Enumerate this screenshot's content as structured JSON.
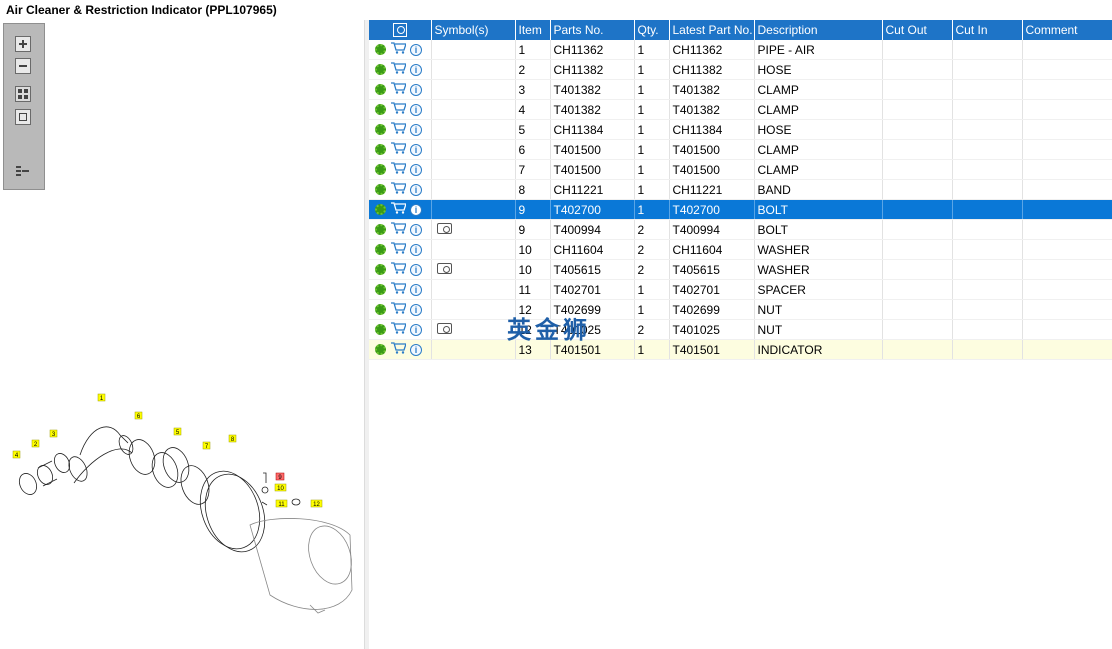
{
  "title": "Air Cleaner & Restriction Indicator (PPL107965)",
  "columns": [
    "",
    "Symbol(s)",
    "Item",
    "Parts No.",
    "Qty.",
    "Latest Part No.",
    "Description",
    "Cut Out",
    "Cut In",
    "Comment"
  ],
  "rows": [
    {
      "symbol": false,
      "item": "1",
      "parts_no": "CH11362",
      "qty": "1",
      "latest": "CH11362",
      "desc": "PIPE - AIR"
    },
    {
      "symbol": false,
      "item": "2",
      "parts_no": "CH11382",
      "qty": "1",
      "latest": "CH11382",
      "desc": "HOSE"
    },
    {
      "symbol": false,
      "item": "3",
      "parts_no": "T401382",
      "qty": "1",
      "latest": "T401382",
      "desc": "CLAMP"
    },
    {
      "symbol": false,
      "item": "4",
      "parts_no": "T401382",
      "qty": "1",
      "latest": "T401382",
      "desc": "CLAMP"
    },
    {
      "symbol": false,
      "item": "5",
      "parts_no": "CH11384",
      "qty": "1",
      "latest": "CH11384",
      "desc": "HOSE"
    },
    {
      "symbol": false,
      "item": "6",
      "parts_no": "T401500",
      "qty": "1",
      "latest": "T401500",
      "desc": "CLAMP"
    },
    {
      "symbol": false,
      "item": "7",
      "parts_no": "T401500",
      "qty": "1",
      "latest": "T401500",
      "desc": "CLAMP"
    },
    {
      "symbol": false,
      "item": "8",
      "parts_no": "CH11221",
      "qty": "1",
      "latest": "CH11221",
      "desc": "BAND"
    },
    {
      "symbol": false,
      "item": "9",
      "parts_no": "T402700",
      "qty": "1",
      "latest": "T402700",
      "desc": "BOLT",
      "state": "selected"
    },
    {
      "symbol": true,
      "item": "9",
      "parts_no": "T400994",
      "qty": "2",
      "latest": "T400994",
      "desc": "BOLT"
    },
    {
      "symbol": false,
      "item": "10",
      "parts_no": "CH11604",
      "qty": "2",
      "latest": "CH11604",
      "desc": "WASHER"
    },
    {
      "symbol": true,
      "item": "10",
      "parts_no": "T405615",
      "qty": "2",
      "latest": "T405615",
      "desc": "WASHER"
    },
    {
      "symbol": false,
      "item": "11",
      "parts_no": "T402701",
      "qty": "1",
      "latest": "T402701",
      "desc": "SPACER"
    },
    {
      "symbol": false,
      "item": "12",
      "parts_no": "T402699",
      "qty": "1",
      "latest": "T402699",
      "desc": "NUT"
    },
    {
      "symbol": true,
      "item": "12",
      "parts_no": "T401025",
      "qty": "2",
      "latest": "T401025",
      "desc": "NUT"
    },
    {
      "symbol": false,
      "item": "13",
      "parts_no": "T401501",
      "qty": "1",
      "latest": "T401501",
      "desc": "INDICATOR",
      "state": "highlight"
    }
  ],
  "watermark": "英金狮",
  "callouts": [
    "1",
    "2",
    "3",
    "4",
    "5",
    "6",
    "7",
    "8",
    "9",
    "10",
    "11",
    "12"
  ],
  "colors": {
    "header": "#1e74c7",
    "selected": "#0a78d7",
    "highlight": "#fdfde0",
    "gear": "#3a9a16"
  }
}
